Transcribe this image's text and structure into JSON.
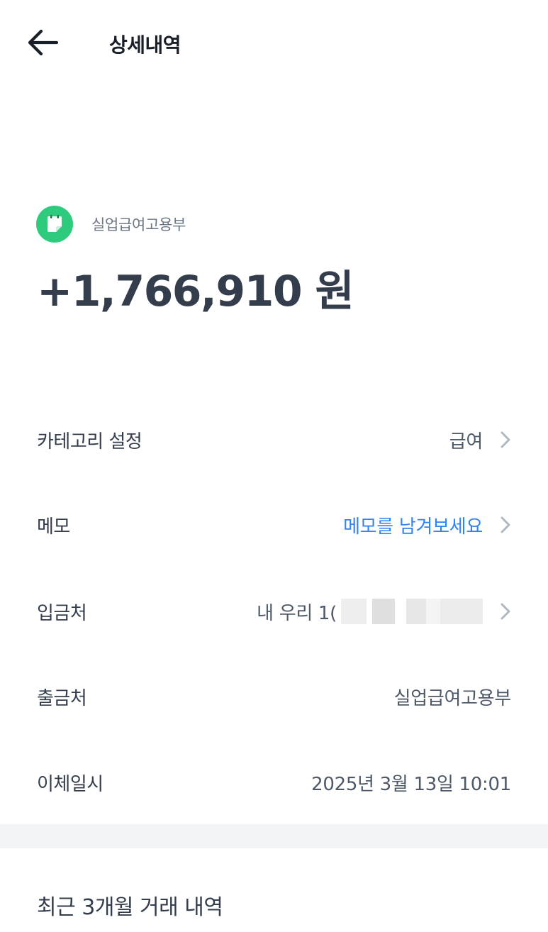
{
  "header": {
    "title": "상세내역",
    "back_icon": "arrow-left-icon"
  },
  "summary": {
    "source_name": "실업급여고용부",
    "source_icon": "memo-note-icon",
    "source_icon_color": "#2fcb7d",
    "amount": "+1,766,910 원"
  },
  "details": {
    "category": {
      "label": "카테고리 설정",
      "value": "급여"
    },
    "memo": {
      "label": "메모",
      "value": "메모를 남겨보세요",
      "value_color": "#3182f6"
    },
    "deposit_to": {
      "label": "입금처",
      "value": "내 우리 1("
    },
    "withdraw_from": {
      "label": "출금처",
      "value": "실업급여고용부"
    },
    "transfer_time": {
      "label": "이체일시",
      "value": "2025년 3월 13일 10:01"
    }
  },
  "recent": {
    "title": "최근 3개월 거래 내역"
  }
}
